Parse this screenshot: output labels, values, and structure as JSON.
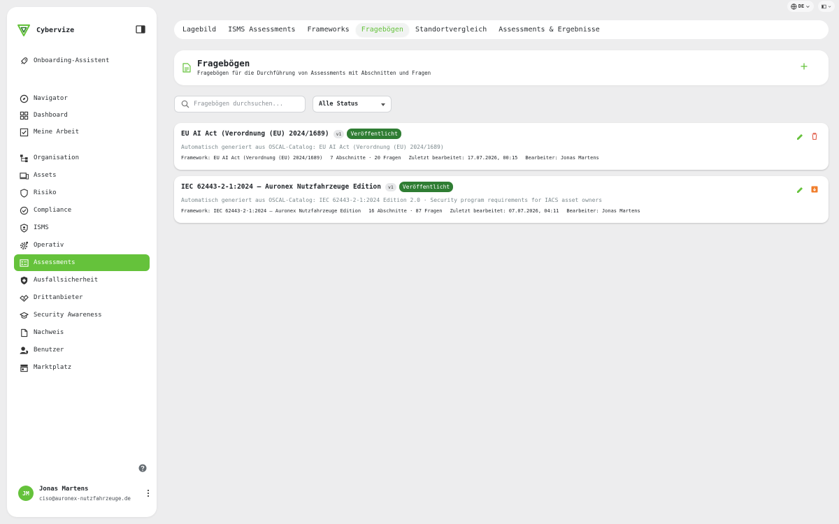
{
  "sidebar": {
    "brand": "Cybervize",
    "items": [
      {
        "label": "Onboarding-Assistent",
        "icon": "rocket-icon"
      },
      {
        "label": "Navigator",
        "icon": "compass-icon"
      },
      {
        "label": "Dashboard",
        "icon": "grid-icon"
      },
      {
        "label": "Meine Arbeit",
        "icon": "checkbox-icon"
      },
      {
        "label": "Organisation",
        "icon": "org-chart-icon"
      },
      {
        "label": "Assets",
        "icon": "devices-icon"
      },
      {
        "label": "Risiko",
        "icon": "shield-outline-icon"
      },
      {
        "label": "Compliance",
        "icon": "verified-check-icon"
      },
      {
        "label": "ISMS",
        "icon": "shield-user-icon"
      },
      {
        "label": "Operativ",
        "icon": "gear-icon"
      },
      {
        "label": "Assessments",
        "icon": "assessment-icon",
        "active": true
      },
      {
        "label": "Ausfallsicherheit",
        "icon": "shield-filled-icon"
      },
      {
        "label": "Drittanbieter",
        "icon": "handshake-icon"
      },
      {
        "label": "Security Awareness",
        "icon": "graduation-cap-icon"
      },
      {
        "label": "Nachweis",
        "icon": "file-icon"
      },
      {
        "label": "Benutzer",
        "icon": "user-shield-icon"
      },
      {
        "label": "Marktplatz",
        "icon": "store-icon"
      }
    ],
    "user": {
      "initials": "JM",
      "name": "Jonas Martens",
      "email": "ciso@auronex-nutzfahrzeuge.de"
    }
  },
  "topbar": {
    "language": "DE"
  },
  "tabs": [
    {
      "label": "Lagebild"
    },
    {
      "label": "ISMS Assessments"
    },
    {
      "label": "Frameworks"
    },
    {
      "label": "Fragebögen",
      "active": true
    },
    {
      "label": "Standortvergleich"
    },
    {
      "label": "Assessments & Ergebnisse"
    }
  ],
  "header": {
    "title": "Fragebögen",
    "subtitle": "Fragebögen für die Durchführung von Assessments mit Abschnitten und Fragen"
  },
  "filters": {
    "search_placeholder": "Fragebögen durchsuchen...",
    "status_selected": "Alle Status"
  },
  "questionnaires": [
    {
      "title": "EU AI Act (Verordnung (EU) 2024/1689)",
      "version": "v1",
      "status": "Veröffentlicht",
      "description": "Automatisch generiert aus OSCAL-Catalog: EU AI Act (Verordnung (EU) 2024/1689)",
      "framework": "Framework: EU AI Act (Verordnung (EU) 2024/1689)",
      "counts": "7 Abschnitte · 20 Fragen",
      "edited": "Zuletzt bearbeitet: 17.07.2026, 00:15",
      "editor": "Bearbeiter: Jonas Martens",
      "action_icon": "trash-icon"
    },
    {
      "title": "IEC 62443-2-1:2024 — Auronex Nutzfahrzeuge Edition",
      "version": "v1",
      "status": "Veröffentlicht",
      "description": "Automatisch generiert aus OSCAL-Catalog: IEC 62443-2-1:2024 Edition 2.0 · Security program requirements for IACS asset owners",
      "framework": "Framework: IEC 62443-2-1:2024 — Auronex Nutzfahrzeuge Edition",
      "counts": "16 Abschnitte · 87 Fragen",
      "edited": "Zuletzt bearbeitet: 07.07.2026, 04:11",
      "editor": "Bearbeiter: Jonas Martens",
      "action_icon": "archive-icon"
    }
  ],
  "colors": {
    "accent": "#65c23b",
    "status": "#2f7d33",
    "danger": "#e05a47",
    "archive": "#f07d2b"
  }
}
